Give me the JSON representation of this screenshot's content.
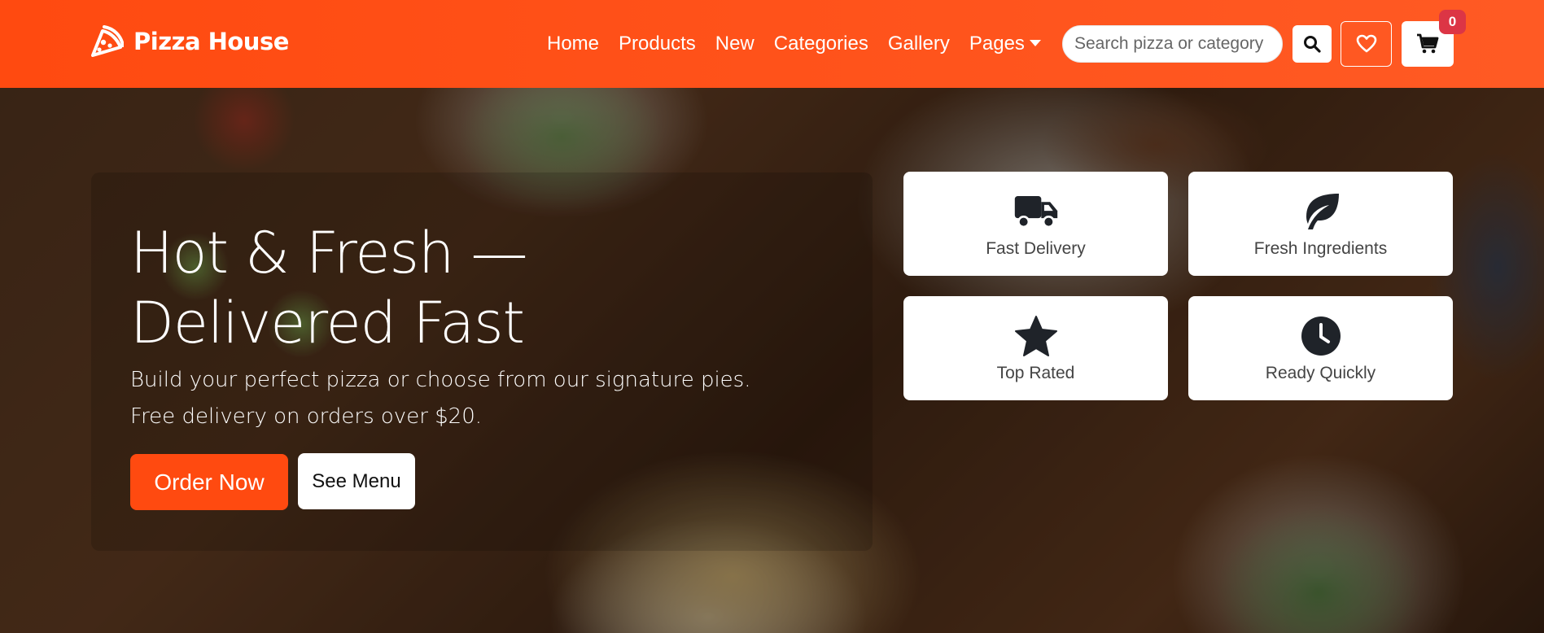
{
  "brand": {
    "name": "Pizza House",
    "icon": "pizza-slice-icon"
  },
  "colors": {
    "primary": "#ff4a10",
    "badge": "#dc3545",
    "icon_dark": "#1f2329"
  },
  "nav": {
    "links": [
      {
        "label": "Home"
      },
      {
        "label": "Products"
      },
      {
        "label": "New"
      },
      {
        "label": "Categories"
      },
      {
        "label": "Gallery"
      },
      {
        "label": "Pages"
      }
    ],
    "search_placeholder": "Search pizza or category",
    "cart_count": "0"
  },
  "hero": {
    "title": "Hot & Fresh — Delivered Fast",
    "subtitle": "Build your perfect pizza or choose from our signature pies. Free delivery on orders over $20.",
    "primary_button": "Order Now",
    "secondary_button": "See Menu"
  },
  "features": [
    {
      "label": "Fast Delivery",
      "icon": "truck-icon"
    },
    {
      "label": "Fresh Ingredients",
      "icon": "leaf-icon"
    },
    {
      "label": "Top Rated",
      "icon": "star-icon"
    },
    {
      "label": "Ready Quickly",
      "icon": "clock-icon"
    }
  ]
}
